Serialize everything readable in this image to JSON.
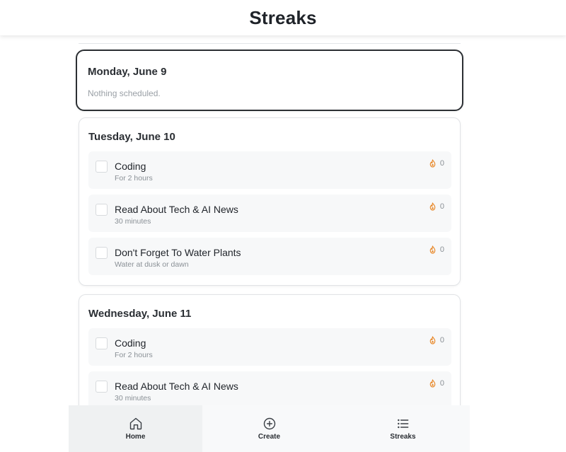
{
  "app": {
    "title": "Streaks"
  },
  "days": [
    {
      "title": "Monday, June 9",
      "selected": true,
      "empty_text": "Nothing scheduled.",
      "tasks": []
    },
    {
      "title": "Tuesday, June 10",
      "selected": false,
      "tasks": [
        {
          "title": "Coding",
          "subtitle": "For 2 hours",
          "streak": "0",
          "checked": false
        },
        {
          "title": "Read About Tech & AI News",
          "subtitle": "30 minutes",
          "streak": "0",
          "checked": false
        },
        {
          "title": "Don't Forget To Water Plants",
          "subtitle": "Water at dusk or dawn",
          "streak": "0",
          "checked": false
        }
      ]
    },
    {
      "title": "Wednesday, June 11",
      "selected": false,
      "tasks": [
        {
          "title": "Coding",
          "subtitle": "For 2 hours",
          "streak": "0",
          "checked": false
        },
        {
          "title": "Read About Tech & AI News",
          "subtitle": "30 minutes",
          "streak": "0",
          "checked": false
        }
      ]
    }
  ],
  "tabs": [
    {
      "label": "Home",
      "icon": "home-icon",
      "active": true
    },
    {
      "label": "Create",
      "icon": "plus-circle-icon",
      "active": false
    },
    {
      "label": "Streaks",
      "icon": "list-icon",
      "active": false
    }
  ],
  "colors": {
    "streak_icon": "#e8892b",
    "selected_border": "#2b2f33",
    "task_bg": "#f7f8f9"
  }
}
